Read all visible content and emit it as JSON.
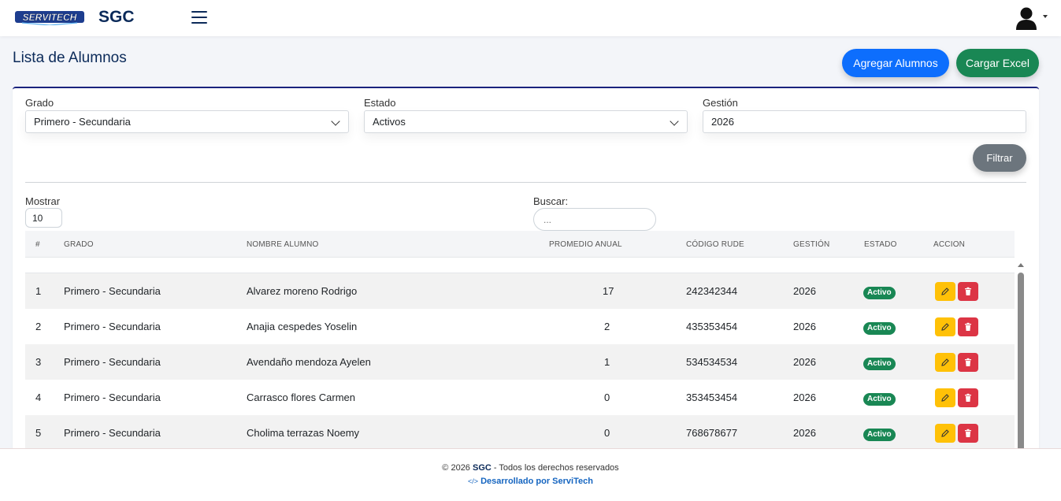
{
  "header": {
    "logo_text": "SERVITECH",
    "brand": "SGC"
  },
  "page": {
    "title": "Lista de Alumnos",
    "add_button": "Agregar Alumnos",
    "excel_button": "Cargar Excel"
  },
  "filters": {
    "grado_label": "Grado",
    "grado_value": "Primero - Secundaria",
    "estado_label": "Estado",
    "estado_value": "Activos",
    "gestion_label": "Gestión",
    "gestion_value": "2026",
    "filter_button": "Filtrar"
  },
  "table_controls": {
    "mostrar_label": "Mostrar",
    "mostrar_value": "10",
    "buscar_label": "Buscar:",
    "buscar_placeholder": "..."
  },
  "table": {
    "headers": [
      "#",
      "GRADO",
      "NOMBRE ALUMNO",
      "PROMEDIO ANUAL",
      "CÓDIGO RUDE",
      "GESTIÓN",
      "ESTADO",
      "ACCION"
    ],
    "rows": [
      {
        "num": "1",
        "grado": "Primero - Secundaria",
        "nombre": "Alvarez moreno Rodrigo",
        "promedio": "17",
        "rude": "242342344",
        "gestion": "2026",
        "estado": "Activo"
      },
      {
        "num": "2",
        "grado": "Primero - Secundaria",
        "nombre": "Anajia cespedes Yoselin",
        "promedio": "2",
        "rude": "435353454",
        "gestion": "2026",
        "estado": "Activo"
      },
      {
        "num": "3",
        "grado": "Primero - Secundaria",
        "nombre": "Avendaño mendoza Ayelen",
        "promedio": "1",
        "rude": "534534534",
        "gestion": "2026",
        "estado": "Activo"
      },
      {
        "num": "4",
        "grado": "Primero - Secundaria",
        "nombre": "Carrasco flores Carmen",
        "promedio": "0",
        "rude": "353453454",
        "gestion": "2026",
        "estado": "Activo"
      },
      {
        "num": "5",
        "grado": "Primero - Secundaria",
        "nombre": "Cholima terrazas Noemy",
        "promedio": "0",
        "rude": "768678677",
        "gestion": "2026",
        "estado": "Activo"
      }
    ]
  },
  "footer": {
    "copyright_prefix": "© 2026",
    "copyright_brand": "SGC",
    "copyright_suffix": "- Todos los derechos reservados",
    "dev_icon": "</>",
    "dev_text": "Desarrollado por ServiTech"
  },
  "colors": {
    "primary": "#0d6efd",
    "success": "#198754",
    "warning": "#ffc107",
    "danger": "#dc3545",
    "brand": "#0b2a59"
  },
  "icons": [
    "menu-icon",
    "user-avatar-icon",
    "chevron-down-icon",
    "pencil-icon",
    "trash-icon",
    "code-icon"
  ]
}
